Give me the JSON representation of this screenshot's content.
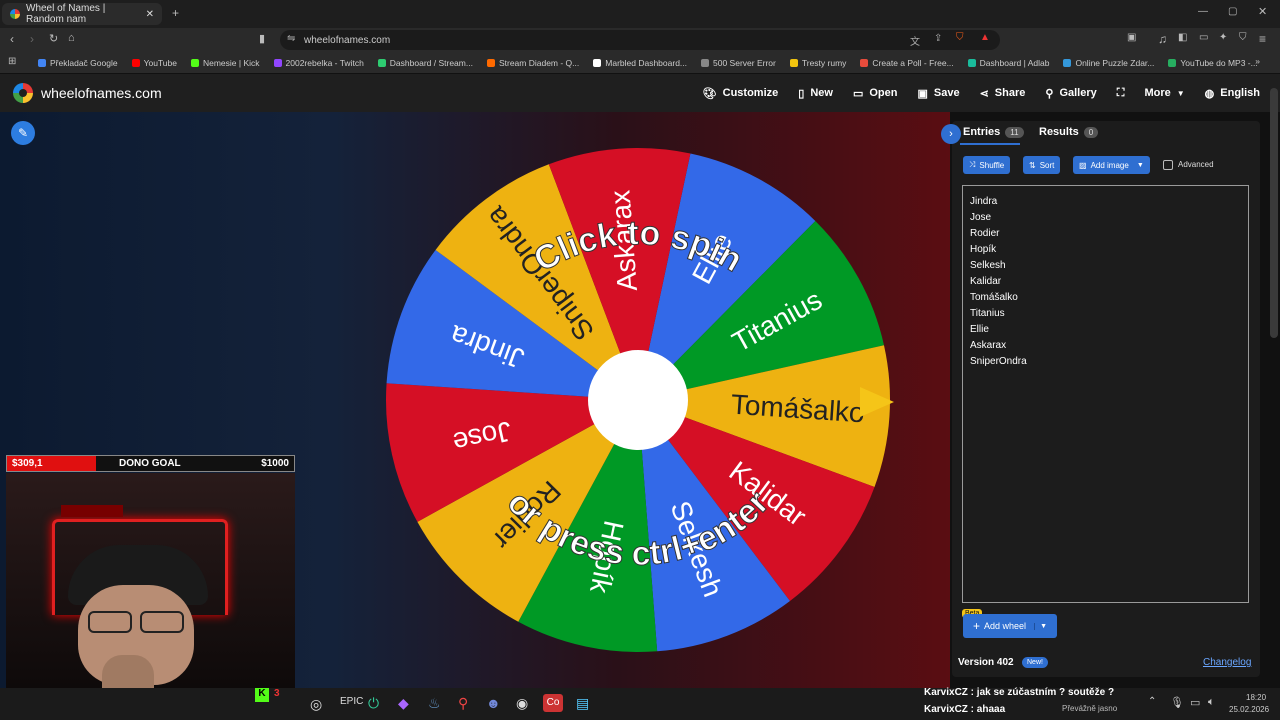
{
  "browser": {
    "tab_title": "Wheel of Names | Random nam",
    "url": "wheelofnames.com",
    "bookmarks": [
      {
        "label": "Překladač Google",
        "color": "#4285f4"
      },
      {
        "label": "YouTube",
        "color": "#ff0000"
      },
      {
        "label": "Nemesie | Kick",
        "color": "#53fc18"
      },
      {
        "label": "2002rebelka - Twitch",
        "color": "#9146ff"
      },
      {
        "label": "Dashboard / Stream...",
        "color": "#2ecc71"
      },
      {
        "label": "Stream Diadem - Q...",
        "color": "#ff6a00"
      },
      {
        "label": "Marbled Dashboard...",
        "color": "#ffffff"
      },
      {
        "label": "500 Server Error",
        "color": "#888888"
      },
      {
        "label": "Tresty rumy",
        "color": "#f1c40f"
      },
      {
        "label": "Create a Poll - Free...",
        "color": "#e74c3c"
      },
      {
        "label": "Dashboard | Adlab",
        "color": "#1abc9c"
      },
      {
        "label": "Online Puzzle Zdar...",
        "color": "#3498db"
      },
      {
        "label": "YouTube do MP3 -...",
        "color": "#27ae60"
      }
    ]
  },
  "site": {
    "logo_text": "wheelofnames.com",
    "nav": {
      "customize": "Customize",
      "new": "New",
      "open": "Open",
      "save": "Save",
      "share": "Share",
      "gallery": "Gallery",
      "more": "More",
      "language": "English"
    }
  },
  "wheel": {
    "line1": "Click to spin",
    "line2": "or press ctrl+enter",
    "slices": [
      {
        "label": "Ellie",
        "color": "#3369e8"
      },
      {
        "label": "Titanius",
        "color": "#009925"
      },
      {
        "label": "Tomášalko",
        "color": "#eeb211"
      },
      {
        "label": "Kalidar",
        "color": "#d50f25"
      },
      {
        "label": "Selkesh",
        "color": "#3369e8"
      },
      {
        "label": "Hopík",
        "color": "#009925"
      },
      {
        "label": "Rodier",
        "color": "#eeb211"
      },
      {
        "label": "Jose",
        "color": "#d50f25"
      },
      {
        "label": "Jindra",
        "color": "#3369e8"
      },
      {
        "label": "SniperOndra",
        "color": "#eeb211"
      },
      {
        "label": "Askarax",
        "color": "#d50f25"
      }
    ]
  },
  "panel": {
    "tab_entries": "Entries",
    "entries_count": "11",
    "tab_results": "Results",
    "results_count": "0",
    "shuffle": "Shuffle",
    "sort": "Sort",
    "add_image": "Add image",
    "advanced": "Advanced",
    "entries": [
      "Jindra",
      "Jose",
      "Rodier",
      "Hopík",
      "Selkesh",
      "Kalidar",
      "Tomášalko",
      "Titanius",
      "Ellie",
      "Askarax",
      "SniperOndra"
    ],
    "beta": "Beta",
    "add_wheel": "Add wheel",
    "version": "Version 402",
    "new_badge": "New!",
    "changelog": "Changelog"
  },
  "overlay": {
    "dono_current": "$309,1",
    "dono_title": "DONO GOAL",
    "dono_target": "$1000",
    "dono_progress": 0.309
  },
  "taskbar": {
    "chat1": "KarvixCZ : jak se zúčastním ? soutěže ?",
    "chat2": "KarvixCZ : ahaaa",
    "weather": "Převážně jasno",
    "time": "18:20",
    "date": "25.02.2026",
    "kick_count": "3"
  }
}
